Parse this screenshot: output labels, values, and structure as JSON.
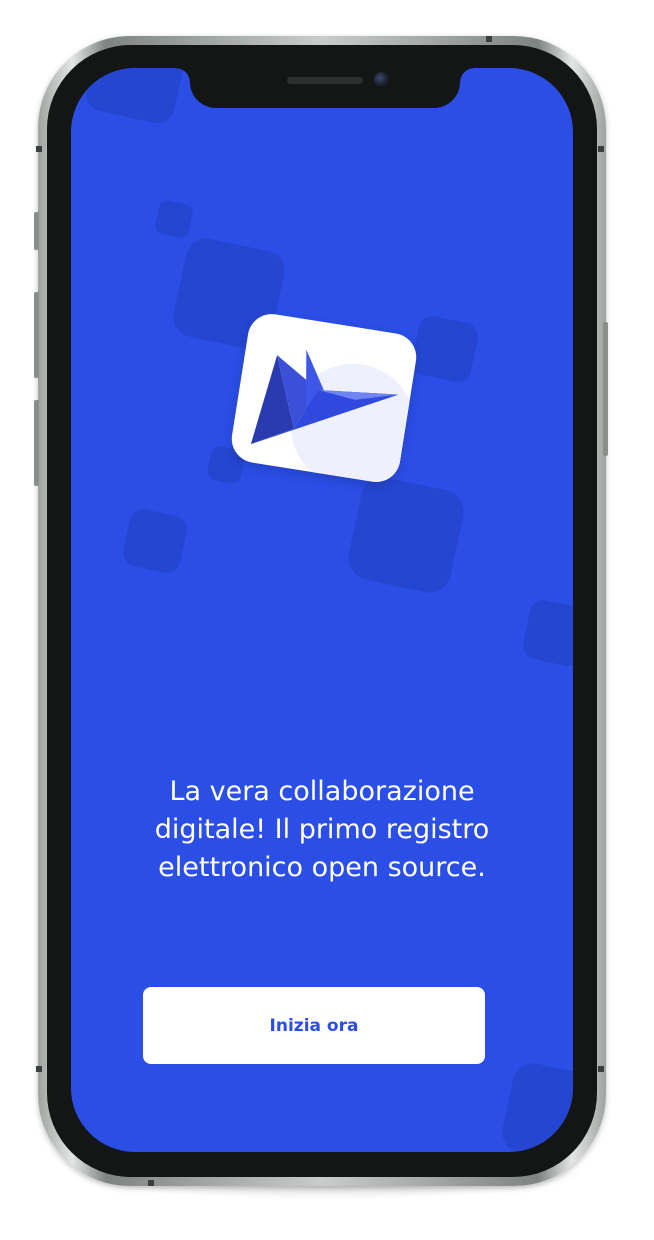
{
  "device": {
    "type": "smartphone",
    "screen_background": "#2a4ee6",
    "accent_square_color": "#2445cc"
  },
  "onboarding": {
    "logo_icon": "paper-bird-logo-icon",
    "tagline": "La vera collaborazione digitale! Il primo registro elettronico open source.",
    "cta_label": "Inizia ora",
    "cta_text_color": "#2a4ee6",
    "cta_background": "#ffffff"
  }
}
